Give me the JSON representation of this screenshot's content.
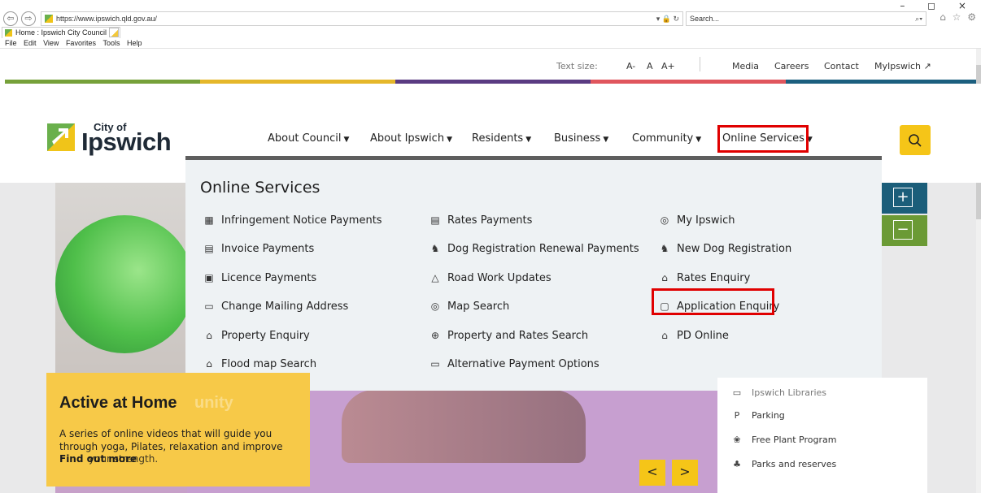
{
  "browser": {
    "url": "https://www.ipswich.qld.gov.au/",
    "search_placeholder": "Search...",
    "tab_title": "Home : Ipswich City Council",
    "tab_close": "×",
    "menu": [
      "File",
      "Edit",
      "View",
      "Favorites",
      "Tools",
      "Help"
    ],
    "window_controls": "–  ◻  ×",
    "toolbar_icons": "⌂ ☆ ⚙",
    "address_tools": "▾ 🔒 ↻",
    "search_dropdown": "⌕▾"
  },
  "utility": {
    "text_size_label": "Text size:",
    "size_small": "A-",
    "size_normal": "A",
    "size_large": "A+",
    "links": [
      "Media",
      "Careers",
      "Contact",
      "MyIpswich"
    ]
  },
  "logo": {
    "small": "City of",
    "big": "Ipswich"
  },
  "nav": {
    "items": [
      "About Council",
      "About Ipswich",
      "Residents",
      "Business",
      "Community",
      "Online Services"
    ],
    "active_index": 5
  },
  "mega_menu": {
    "title": "Online Services",
    "col1": [
      {
        "icon": "▦",
        "label": "Infringement Notice Payments"
      },
      {
        "icon": "▤",
        "label": "Invoice Payments"
      },
      {
        "icon": "▣",
        "label": "Licence Payments"
      },
      {
        "icon": "▭",
        "label": "Change Mailing Address"
      },
      {
        "icon": "⌂",
        "label": "Property Enquiry"
      },
      {
        "icon": "⌂",
        "label": "Flood map Search"
      }
    ],
    "col2": [
      {
        "icon": "▤",
        "label": "Rates Payments"
      },
      {
        "icon": "♞",
        "label": "Dog Registration Renewal Payments"
      },
      {
        "icon": "△",
        "label": "Road Work Updates"
      },
      {
        "icon": "◎",
        "label": "Map Search"
      },
      {
        "icon": "⊕",
        "label": "Property and Rates Search"
      },
      {
        "icon": "▭",
        "label": "Alternative Payment Options"
      }
    ],
    "col3": [
      {
        "icon": "◎",
        "label": "My Ipswich"
      },
      {
        "icon": "♞",
        "label": "New Dog Registration"
      },
      {
        "icon": "⌂",
        "label": "Rates Enquiry"
      },
      {
        "icon": "▢",
        "label": "Application Enquiry"
      },
      {
        "icon": "⌂",
        "label": "PD Online"
      }
    ]
  },
  "promo": {
    "title": "Active at Home",
    "ghost": "unity",
    "body": "A series of online videos that will guide you through yoga, Pilates, relaxation and improve",
    "link": "Find out more",
    "link_overlap": "your strength."
  },
  "slider": {
    "prev": "<",
    "next": ">"
  },
  "side_links": [
    {
      "icon": "▭",
      "label": "Ipswich Libraries"
    },
    {
      "icon": "P",
      "label": "Parking"
    },
    {
      "icon": "❀",
      "label": "Free Plant Program"
    },
    {
      "icon": "♣",
      "label": "Parks and reserves"
    }
  ],
  "zoom": {
    "plus": "+",
    "minus": "−"
  },
  "colors": {
    "accent_yellow": "#f5c518",
    "highlight_red": "#e00000",
    "bar_green": "#76a13a",
    "bar_yellow": "#e5b72a",
    "bar_purple": "#5a3b82",
    "bar_red": "#e0565d",
    "bar_blue": "#1c5f7f"
  }
}
